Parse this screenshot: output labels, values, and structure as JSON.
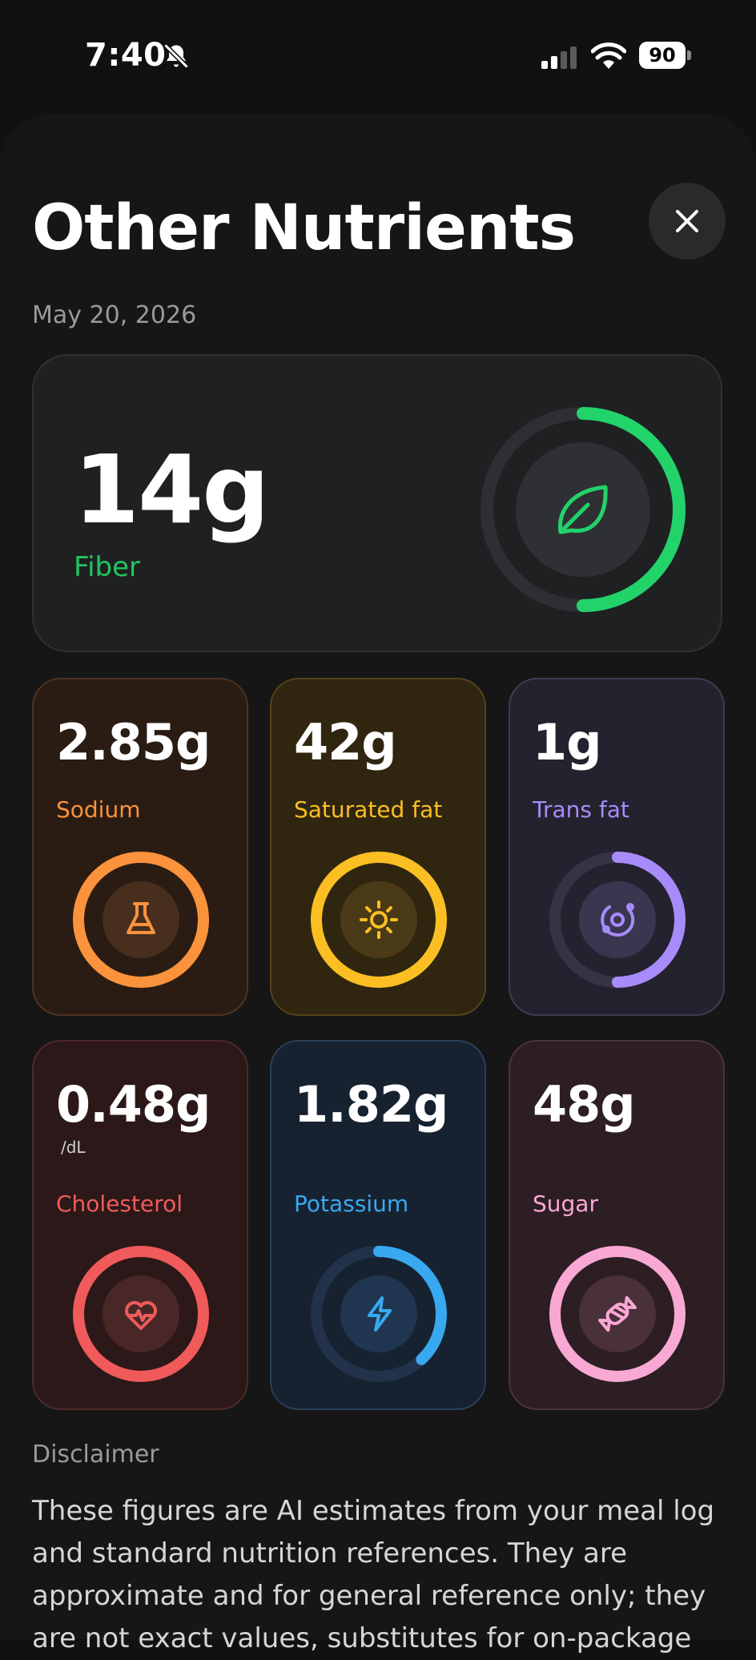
{
  "status": {
    "time": "7:40",
    "battery": "90"
  },
  "sheet": {
    "title": "Other Nutrients",
    "date": "May 20, 2026"
  },
  "fiber": {
    "value": "14g",
    "label": "Fiber",
    "icon": "leaf-icon",
    "color": "#22d36a",
    "progress": 0.5
  },
  "nutrients": [
    {
      "value": "2.85g",
      "label": "Sodium",
      "icon": "flask-icon",
      "color": "#fb923c",
      "progress": 1.0
    },
    {
      "value": "42g",
      "label": "Saturated fat",
      "icon": "sun-icon",
      "color": "#fbbf24",
      "progress": 1.0
    },
    {
      "value": "1g",
      "label": "Trans fat",
      "icon": "orbit-icon",
      "color": "#a78bfa",
      "progress": 0.5
    },
    {
      "value": "0.48g",
      "unit": "/dL",
      "label": "Cholesterol",
      "icon": "heartbeat-icon",
      "color": "#f05a5a",
      "progress": 1.0
    },
    {
      "value": "1.82g",
      "label": "Potassium",
      "icon": "lightning-icon",
      "color": "#38a9f0",
      "progress": 0.38
    },
    {
      "value": "48g",
      "label": "Sugar",
      "icon": "candy-icon",
      "color": "#f9a8d4",
      "progress": 1.0
    }
  ],
  "disclaimer": {
    "title": "Disclaimer",
    "text": "These figures are AI estimates from your meal log and standard nutrition references. They are approximate and for general reference only; they are not exact values, substitutes for on-package"
  }
}
